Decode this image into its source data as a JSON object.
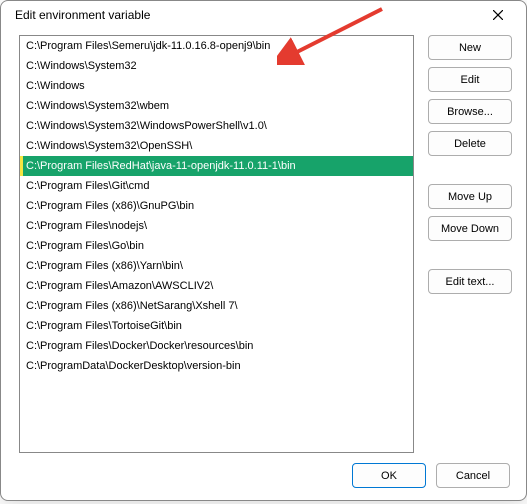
{
  "title": "Edit environment variable",
  "list": {
    "items": [
      "C:\\Program Files\\Semeru\\jdk-11.0.16.8-openj9\\bin",
      "C:\\Windows\\System32",
      "C:\\Windows",
      "C:\\Windows\\System32\\wbem",
      "C:\\Windows\\System32\\WindowsPowerShell\\v1.0\\",
      "C:\\Windows\\System32\\OpenSSH\\",
      "C:\\Program Files\\RedHat\\java-11-openjdk-11.0.11-1\\bin",
      "C:\\Program Files\\Git\\cmd",
      "C:\\Program Files (x86)\\GnuPG\\bin",
      "C:\\Program Files\\nodejs\\",
      "C:\\Program Files\\Go\\bin",
      "C:\\Program Files (x86)\\Yarn\\bin\\",
      "C:\\Program Files\\Amazon\\AWSCLIV2\\",
      "C:\\Program Files (x86)\\NetSarang\\Xshell 7\\",
      "C:\\Program Files\\TortoiseGit\\bin",
      "C:\\Program Files\\Docker\\Docker\\resources\\bin",
      "C:\\ProgramData\\DockerDesktop\\version-bin"
    ],
    "selected_index": 6
  },
  "buttons": {
    "new": "New",
    "edit": "Edit",
    "browse": "Browse...",
    "delete": "Delete",
    "move_up": "Move Up",
    "move_down": "Move Down",
    "edit_text": "Edit text...",
    "ok": "OK",
    "cancel": "Cancel"
  },
  "annotation": {
    "arrow_color": "#e43b2f"
  }
}
